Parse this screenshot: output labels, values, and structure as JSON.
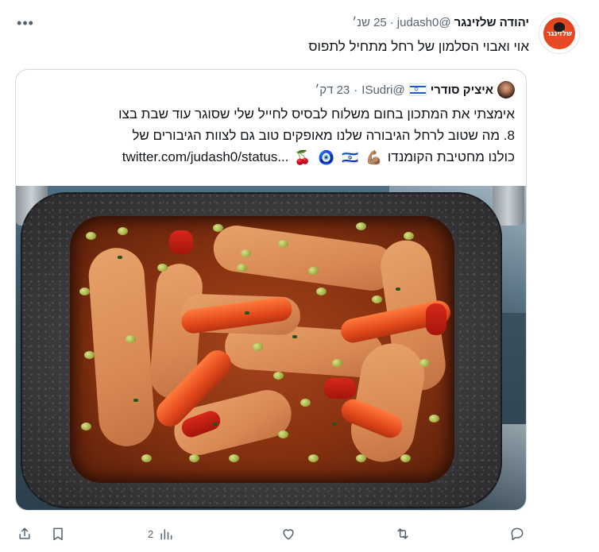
{
  "tweet": {
    "author_name": "יהודה שלזינגר",
    "handle": "@judash0",
    "separator": "·",
    "time": "25 שנ׳",
    "avatar_text": "שלזינגר",
    "text": "אוי ואבוי הסלמון של רחל מתחיל לתפוס",
    "more_icon": "more-dots-icon"
  },
  "quote": {
    "author_name": "איציק סודרי",
    "handle": "@ISudri",
    "separator": "·",
    "time": "23 דק׳",
    "lines": [
      "אימצתי את המתכון בחום משלוח לבסיס לחייל שלי שסוגר עוד שבת בצו",
      "8. מה שטוב לרחל הגיבורה שלנו מאופקים טוב גם לצוות הגיבורים של",
      "כולנו מחטיבת הקומנדו",
      "twitter.com/judash0/status..."
    ],
    "emojis": [
      "💪🏽",
      "🇮🇱",
      "🧿",
      "🍒"
    ]
  },
  "actions": {
    "reply_icon": "reply-icon",
    "retweet_icon": "retweet-icon",
    "like_icon": "heart-icon",
    "views_icon": "views-chart-icon",
    "views_count": "2",
    "bookmark_icon": "bookmark-icon",
    "share_icon": "share-icon"
  },
  "colors": {
    "text": "#0f1419",
    "muted": "#536471",
    "border": "#cfd9de"
  }
}
